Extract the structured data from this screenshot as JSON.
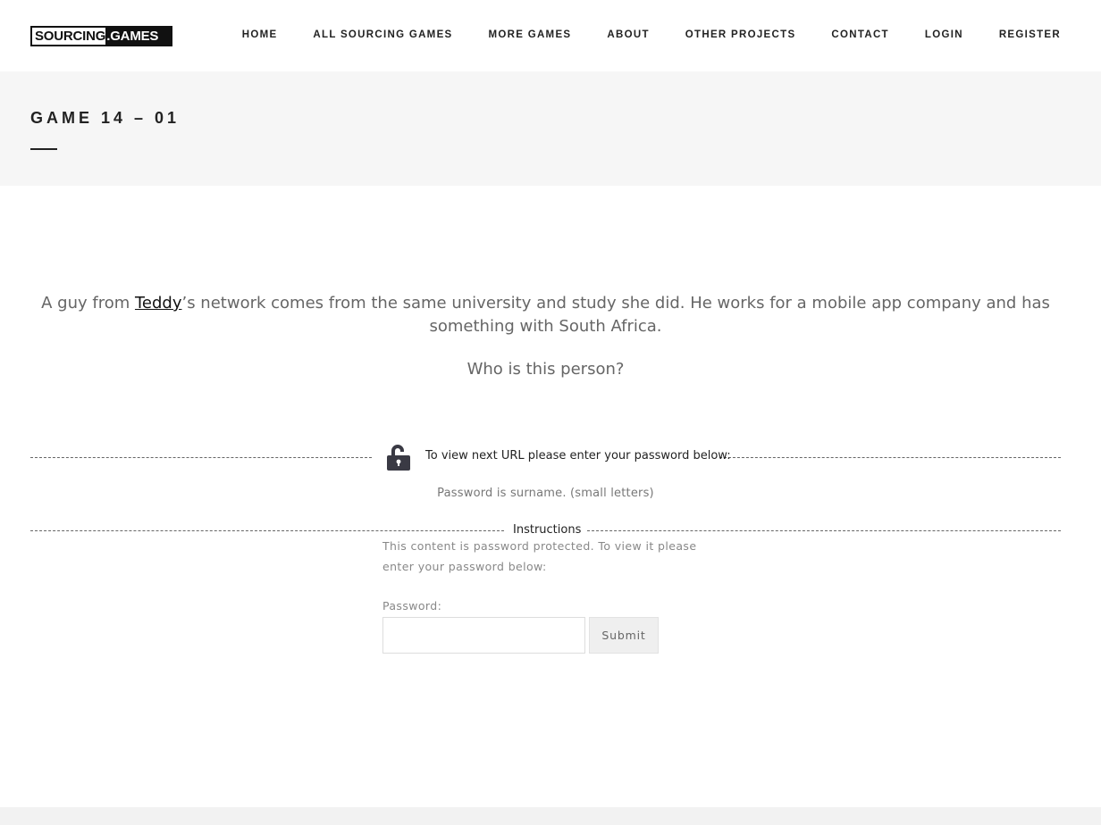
{
  "header": {
    "logo_left": "SOURCING",
    "logo_right": ".GAMES",
    "nav": [
      {
        "label": "HOME"
      },
      {
        "label": "ALL SOURCING GAMES"
      },
      {
        "label": "MORE GAMES"
      },
      {
        "label": "ABOUT"
      },
      {
        "label": "OTHER PROJECTS"
      },
      {
        "label": "CONTACT"
      },
      {
        "label": "LOGIN"
      },
      {
        "label": "REGISTER"
      }
    ]
  },
  "title_band": {
    "title": "GAME 14 – 01"
  },
  "content": {
    "question_pre": "A guy from ",
    "question_link": "Teddy",
    "question_post": "’s network comes from the same university and study she did. He works for a mobile app company and has something with South Africa.",
    "question2": "Who is this person?",
    "lock_text": "To view next URL please enter your password below:",
    "pw_hint": "Password is surname. (small letters)",
    "instructions_label": "Instructions",
    "protect_text": "This content is password protected. To view it please enter your password below:",
    "password_label": "Password:",
    "password_value": "",
    "submit_label": "Submit"
  },
  "icons": {
    "lock": "unlock-icon"
  }
}
